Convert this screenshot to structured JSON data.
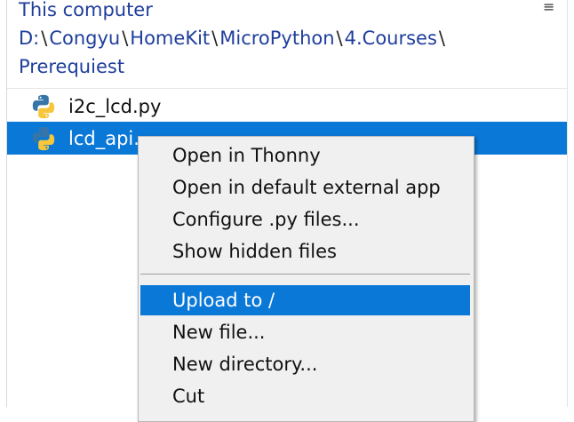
{
  "header": {
    "location_title": "This computer",
    "breadcrumbs": [
      "D:",
      "Congyu",
      "HomeKit",
      "MicroPython",
      "4.Courses",
      "Prerequiest"
    ],
    "separator": "\\",
    "menu_icon": "hamburger-menu-icon"
  },
  "files": [
    {
      "name": "i2c_lcd.py",
      "icon": "python-file-icon",
      "selected": false
    },
    {
      "name": "lcd_api.",
      "icon": "python-file-icon",
      "selected": true
    }
  ],
  "context_menu": {
    "items": [
      {
        "label": "Open in Thonny"
      },
      {
        "label": "Open in default external app"
      },
      {
        "label": "Configure .py files..."
      },
      {
        "label": "Show hidden files"
      },
      {
        "label": "Upload to /",
        "highlighted": true
      },
      {
        "label": "New file..."
      },
      {
        "label": "New directory..."
      },
      {
        "label": "Cut"
      }
    ]
  },
  "colors": {
    "selection": "#0a78d7",
    "path_text": "#1f3e9c",
    "menu_background": "#f0f0f0"
  }
}
